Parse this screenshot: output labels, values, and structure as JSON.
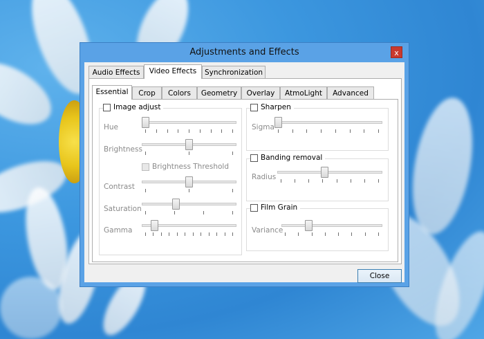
{
  "window": {
    "title": "Adjustments and Effects",
    "close_glyph": "x"
  },
  "top_tabs": [
    "Audio Effects",
    "Video Effects",
    "Synchronization"
  ],
  "sub_tabs": [
    "Essential",
    "Crop",
    "Colors",
    "Geometry",
    "Overlay",
    "AtmoLight",
    "Advanced"
  ],
  "image_adjust": {
    "label": "Image adjust",
    "checked": false,
    "sliders": [
      {
        "label": "Hue",
        "value": 0.0
      },
      {
        "label": "Brightness",
        "value": 0.5
      },
      {
        "label": "Contrast",
        "value": 0.5
      },
      {
        "label": "Saturation",
        "value": 0.35
      },
      {
        "label": "Gamma",
        "value": 0.1
      }
    ],
    "brightness_threshold_label": "Brightness Threshold"
  },
  "sharpen": {
    "label": "Sharpen",
    "slider_label": "Sigma",
    "value": 0.0
  },
  "banding_removal": {
    "label": "Banding removal",
    "slider_label": "Radius",
    "value": 0.45
  },
  "film_grain": {
    "label": "Film Grain",
    "slider_label": "Variance",
    "value": 0.25
  },
  "footer": {
    "close_label": "Close"
  }
}
